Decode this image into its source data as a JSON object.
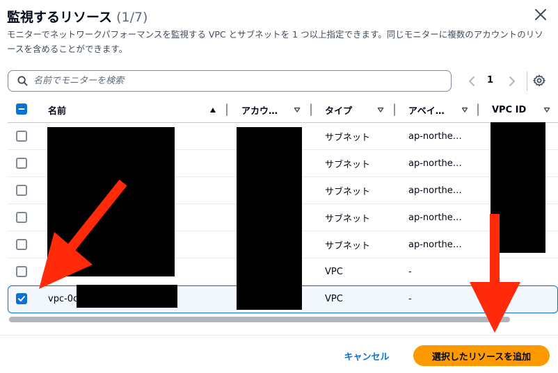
{
  "modal": {
    "title": "監視するリソース",
    "count": "(1/7)",
    "description": "モニターでネットワークパフォーマンスを監視する VPC とサブネットを 1 つ以上指定できます。同じモニターに複数のアカウントのリソースを含めることができます。",
    "close_icon": "close-icon"
  },
  "search": {
    "placeholder": "名前でモニターを検索",
    "value": "",
    "icon": "search-icon"
  },
  "pagination": {
    "current_page": "1",
    "prev_icon": "chevron-left-icon",
    "next_icon": "chevron-right-icon"
  },
  "settings": {
    "icon": "gear-icon"
  },
  "table": {
    "columns": [
      {
        "label": "名前",
        "sort": "ascending"
      },
      {
        "label": "アカウ…",
        "sort": "none"
      },
      {
        "label": "タイプ",
        "sort": "none"
      },
      {
        "label": "アベイ…",
        "sort": "none"
      },
      {
        "label": "VPC ID",
        "sort": "none"
      }
    ],
    "header_checkbox": "indeterminate",
    "rows": [
      {
        "selected": false,
        "name": "",
        "account": "",
        "type": "サブネット",
        "az": "ap-northe…",
        "vpc_id": ""
      },
      {
        "selected": false,
        "name": "",
        "account": "",
        "type": "サブネット",
        "az": "ap-northe…",
        "vpc_id": ""
      },
      {
        "selected": false,
        "name": "",
        "account": "",
        "type": "サブネット",
        "az": "ap-northe…",
        "vpc_id": ""
      },
      {
        "selected": false,
        "name": "",
        "account": "",
        "type": "サブネット",
        "az": "ap-northe…",
        "vpc_id": ""
      },
      {
        "selected": false,
        "name": "",
        "account": "",
        "type": "サブネット",
        "az": "ap-northe…",
        "vpc_id": ""
      },
      {
        "selected": false,
        "name": "",
        "account": "",
        "type": "VPC",
        "az": "-",
        "vpc_id": ""
      },
      {
        "selected": true,
        "name": "vpc-0c",
        "account": "",
        "type": "VPC",
        "az": "-",
        "vpc_id": ""
      }
    ]
  },
  "footer": {
    "cancel_label": "キャンセル",
    "primary_label": "選択したリソースを追加"
  },
  "colors": {
    "primary_button": "#ff9900",
    "link": "#0972d3",
    "annotation_arrow": "#ff2a0a",
    "selection_border": "#0972d3"
  }
}
